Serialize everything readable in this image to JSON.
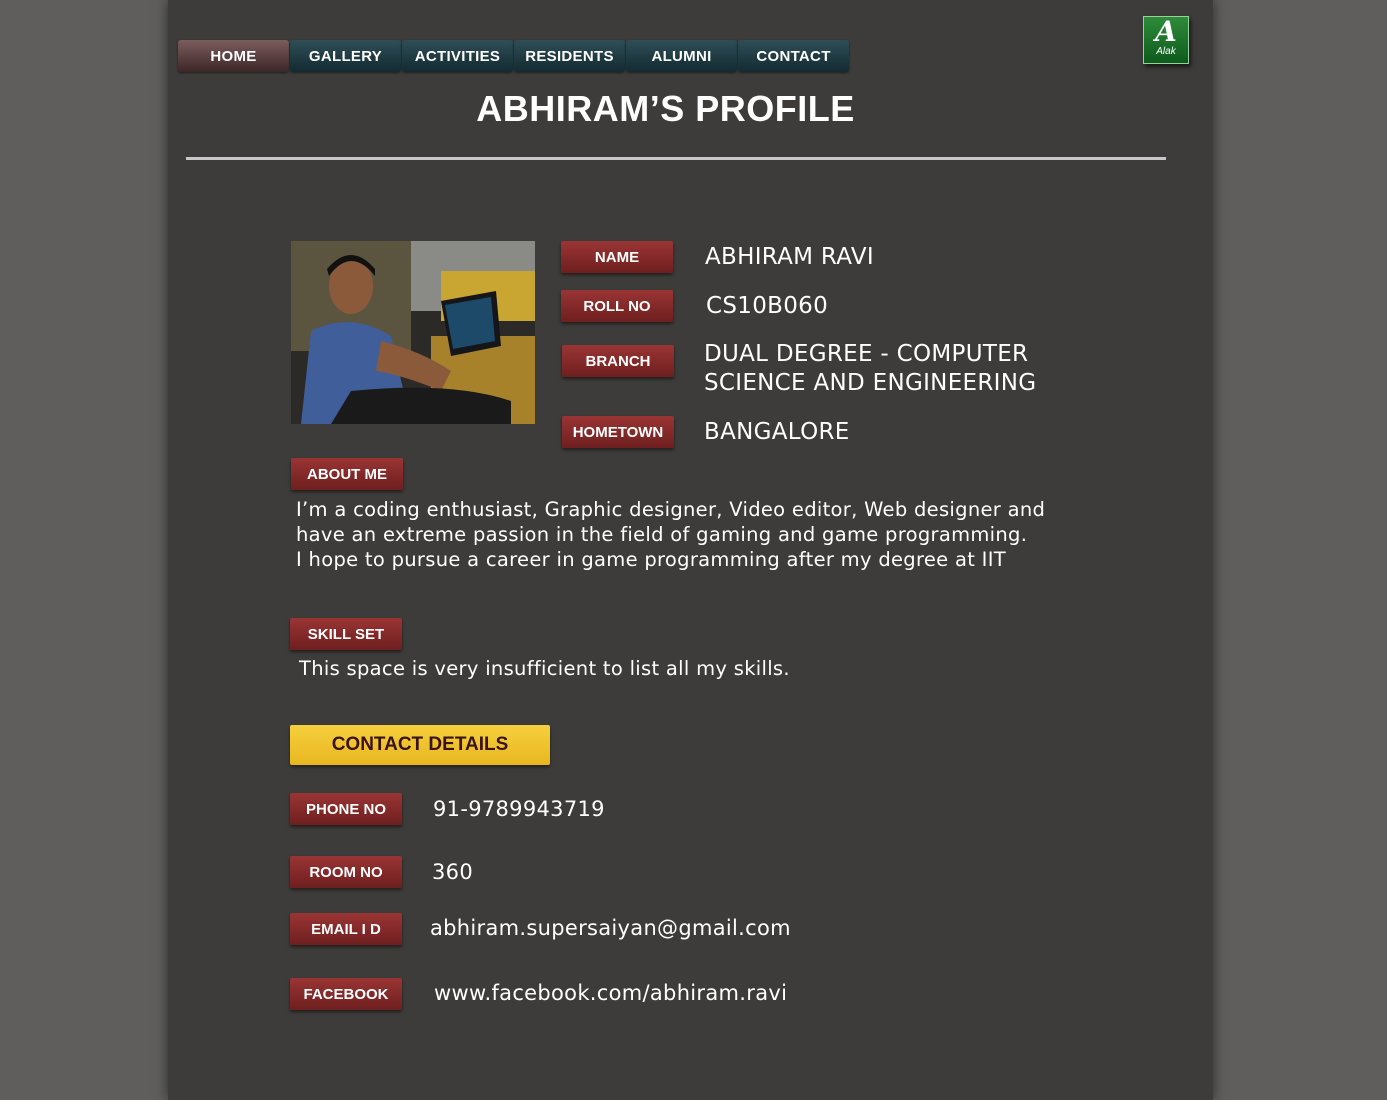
{
  "nav": {
    "items": [
      {
        "label": "HOME",
        "active": true
      },
      {
        "label": "GALLERY"
      },
      {
        "label": "ACTIVITIES"
      },
      {
        "label": "RESIDENTS"
      },
      {
        "label": "ALUMNI"
      },
      {
        "label": "CONTACT"
      }
    ]
  },
  "logo": {
    "letter": "A",
    "text": "Alak"
  },
  "page_title": "ABHIRAM’S PROFILE",
  "profile": {
    "name_label": "NAME",
    "name": "ABHIRAM RAVI",
    "roll_label": "ROLL NO",
    "roll": "CS10B060",
    "branch_label": "BRANCH",
    "branch_line1": "DUAL DEGREE - COMPUTER",
    "branch_line2": "SCIENCE AND ENGINEERING",
    "hometown_label": "HOMETOWN",
    "hometown": "BANGALORE"
  },
  "about": {
    "label": "ABOUT ME",
    "line1": "I’m a coding enthusiast, Graphic designer, Video editor, Web designer and",
    "line2": "have an extreme passion in the field of gaming and game programming.",
    "line3": "I hope to pursue a career in game programming after my degree at IIT"
  },
  "skills": {
    "label": "SKILL SET",
    "text": "This space is very insufficient to list all my skills."
  },
  "contact": {
    "heading": "CONTACT DETAILS",
    "phone_label": "PHONE NO",
    "phone": "91-9789943719",
    "room_label": "ROOM NO",
    "room": "360",
    "email_label": "EMAIL I D",
    "email": "abhiram.supersaiyan@gmail.com",
    "facebook_label": "FACEBOOK",
    "facebook": "www.facebook.com/abhiram.ravi"
  },
  "colors": {
    "page_bg": "#3d3c3a",
    "outer_bg": "#5f5e5c",
    "tag_red": "#8a2c2c",
    "contact_yellow": "#f2c430",
    "nav_teal": "#1d3a42"
  }
}
